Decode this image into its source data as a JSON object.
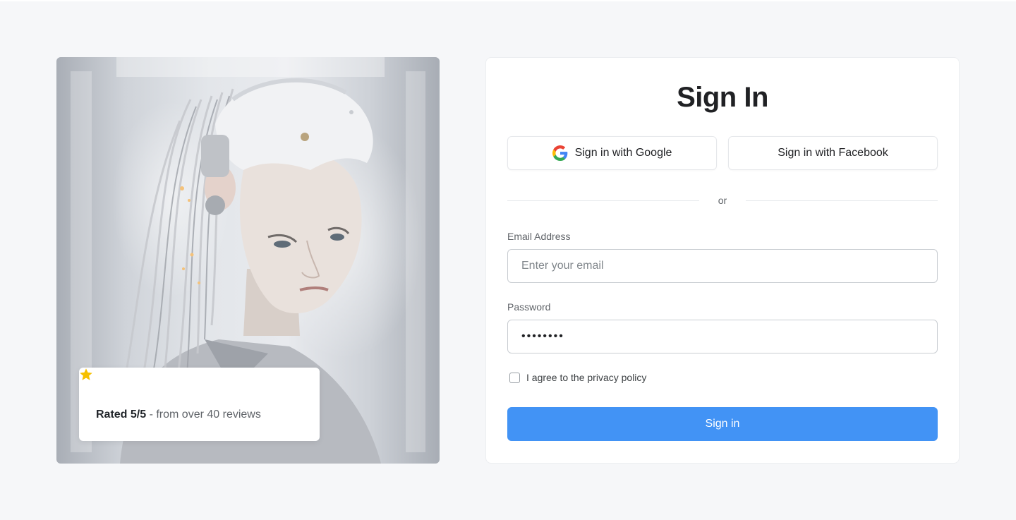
{
  "hero": {
    "image_description": "robot-woman-portrait",
    "rating": {
      "stars": 5,
      "star_color": "#f6c000",
      "rated_label": "Rated 5/5",
      "rated_suffix": " - from over 40 reviews"
    }
  },
  "signin": {
    "title": "Sign In",
    "google_label": "Sign in with Google",
    "facebook_label": "Sign in with Facebook",
    "divider_text": "or",
    "email_label": "Email Address",
    "email_placeholder": "Enter your email",
    "password_label": "Password",
    "password_value": "••••••••",
    "agree_label": "I agree to the privacy policy",
    "submit_label": "Sign in",
    "accent_color": "#4293f5"
  }
}
